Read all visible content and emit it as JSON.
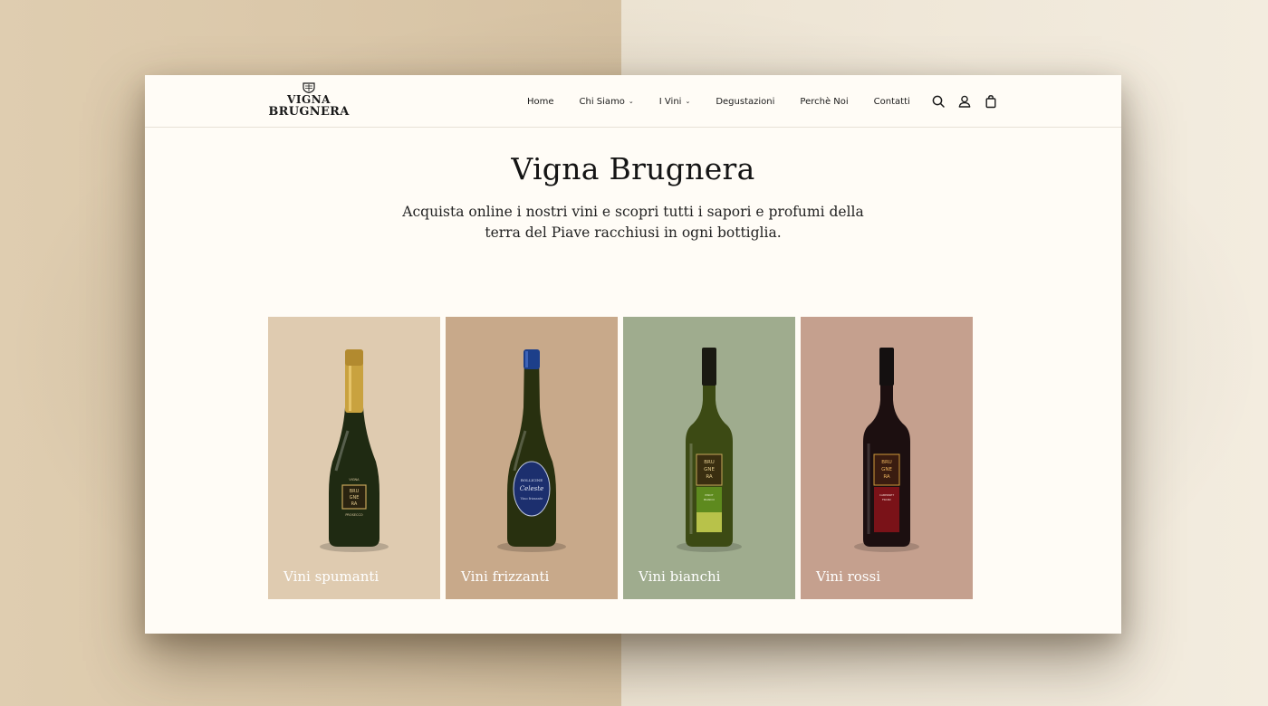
{
  "header": {
    "logo": {
      "line1": "VIGNA",
      "line2": "BRUGNERA"
    },
    "nav": [
      {
        "label": "Home",
        "has_dropdown": false
      },
      {
        "label": "Chi Siamo",
        "has_dropdown": true
      },
      {
        "label": "I Vini",
        "has_dropdown": true
      },
      {
        "label": "Degustazioni",
        "has_dropdown": false
      },
      {
        "label": "Perchè Noi",
        "has_dropdown": false
      },
      {
        "label": "Contatti",
        "has_dropdown": false
      }
    ],
    "icons": [
      "search-icon",
      "account-icon",
      "shopping-bag-icon"
    ]
  },
  "hero": {
    "title": "Vigna Brugnera",
    "subtitle": "Acquista online i nostri vini e scopri tutti i sapori e profumi della terra del Piave racchiusi in ogni bottiglia."
  },
  "categories": [
    {
      "label": "Vini spumanti",
      "bg": "#dfcbb0"
    },
    {
      "label": "Vini frizzanti",
      "bg": "#c8a98a"
    },
    {
      "label": "Vini bianchi",
      "bg": "#9fac8e"
    },
    {
      "label": "Vini rossi",
      "bg": "#c5a08e"
    }
  ],
  "colors": {
    "page_bg": "#fffcf6",
    "text": "#141414",
    "bottle_green": "#1e2a10",
    "foil_gold": "#c8a040",
    "foil_blue": "#1d3f8a"
  }
}
